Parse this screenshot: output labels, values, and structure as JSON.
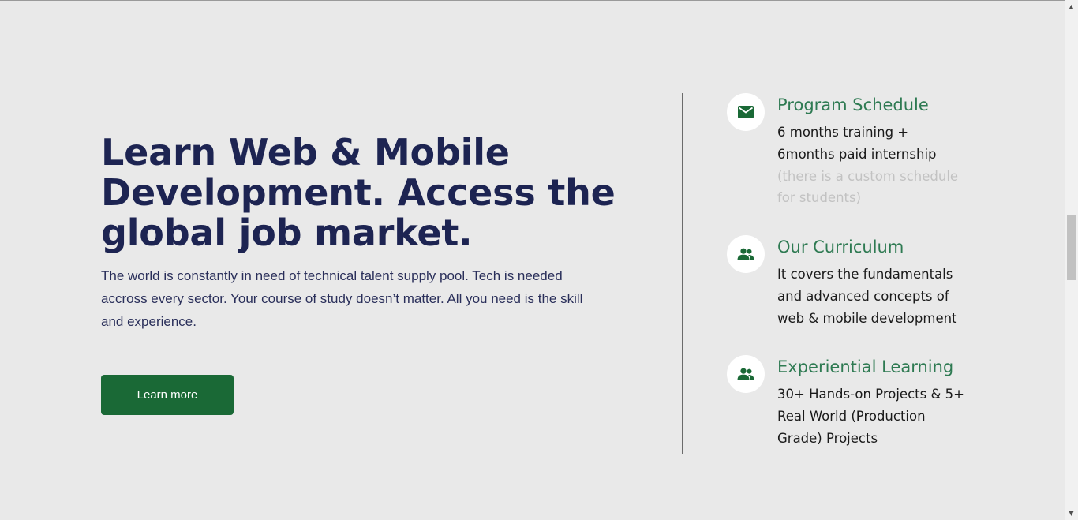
{
  "hero": {
    "title": "Learn Web & Mobile Development. Access the global job market.",
    "description": "The world is constantly in need of technical talent supply pool. Tech is needed accross every sector. Your course of study doesn’t matter. All you need is the skill and experience.",
    "button_label": "Learn more"
  },
  "features": [
    {
      "icon": "mail-icon",
      "title": "Program Schedule",
      "description": "6 months training + 6months paid internship",
      "note": "(there is a custom schedule for students)"
    },
    {
      "icon": "people-icon",
      "title": "Our Curriculum",
      "description": "It covers the fundamentals and advanced concepts of web & mobile development"
    },
    {
      "icon": "people-icon",
      "title": "Experiential Learning",
      "description": "30+ Hands-on Projects & 5+ Real World (Production Grade) Projects"
    }
  ],
  "colors": {
    "background": "#e9e9e9",
    "heading": "#1d2452",
    "accent_green": "#1a6936",
    "feature_title": "#2e7a52"
  },
  "scrollbar": {
    "up_arrow": "▲",
    "down_arrow": "▼"
  }
}
